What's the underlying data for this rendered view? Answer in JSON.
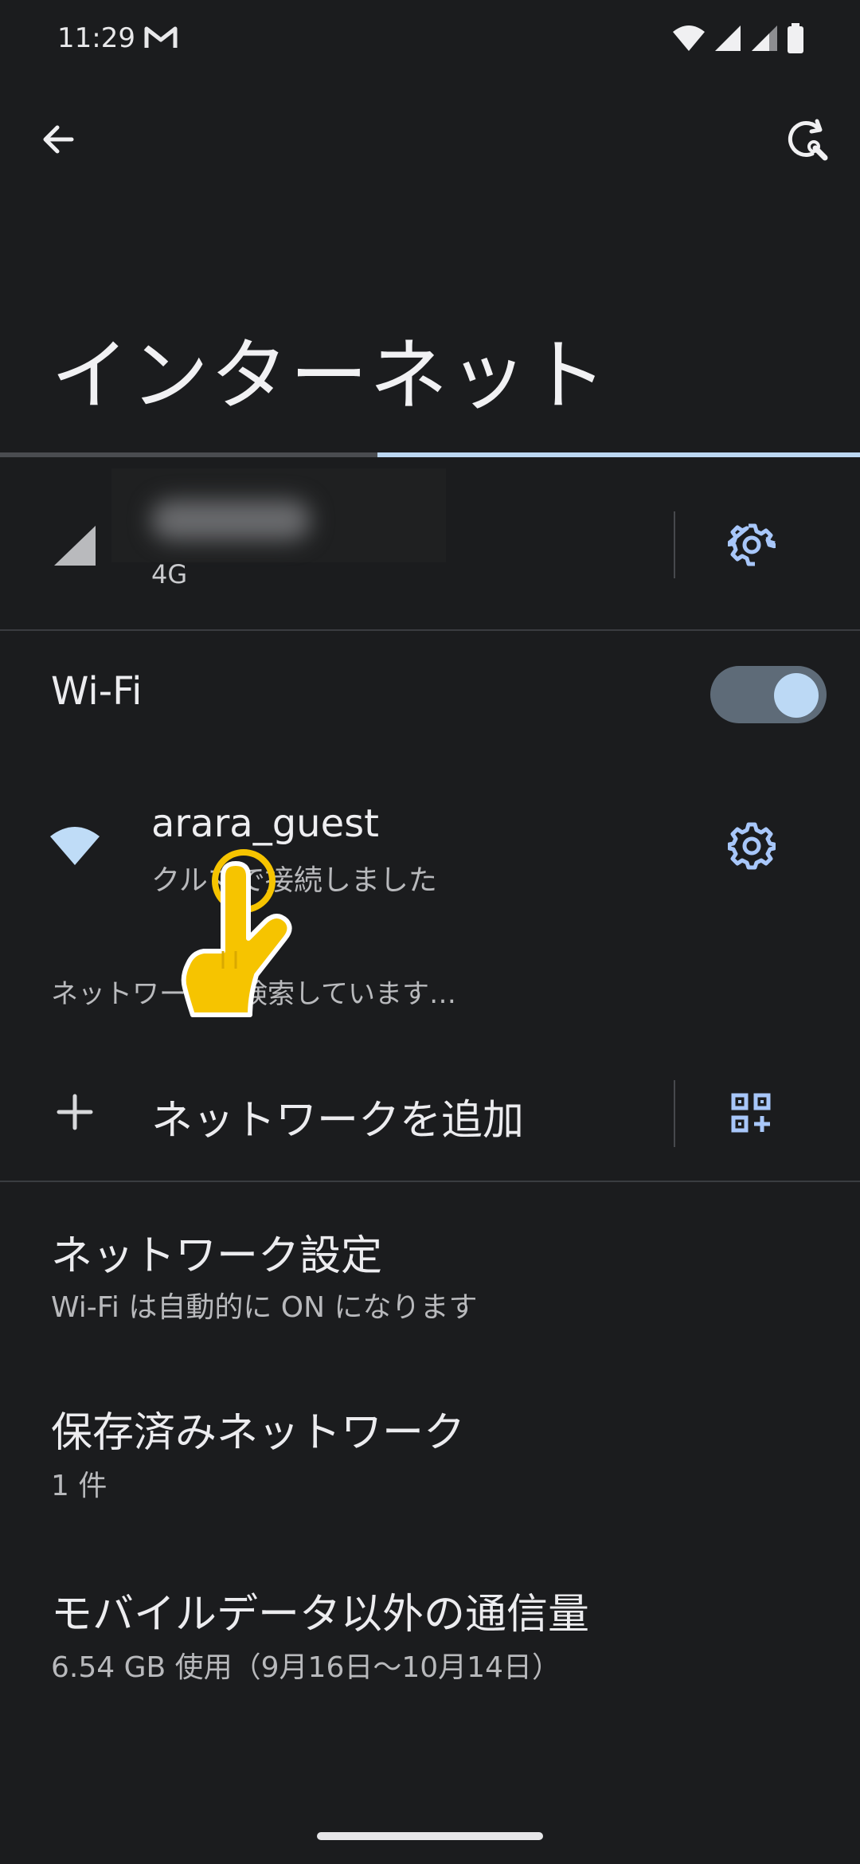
{
  "status_bar": {
    "time": "11:29",
    "icons": [
      "gmail-icon",
      "wifi-icon",
      "signal-icon",
      "signal-icon-2",
      "battery-icon"
    ]
  },
  "toolbar": {
    "back_icon": "arrow-back-icon",
    "action_icon": "refresh-wrench-icon"
  },
  "page": {
    "title": "インターネット"
  },
  "mobile": {
    "network_type": "4G",
    "settings_icon": "gear-icon"
  },
  "wifi": {
    "label": "Wi-Fi",
    "enabled": true,
    "network": {
      "name": "arara_guest",
      "status": "クルマで接続しました",
      "settings_icon": "gear-icon"
    },
    "searching_text": "ネットワークを検索しています…",
    "add_network_label": "ネットワークを追加",
    "qr_icon": "qr-add-icon"
  },
  "items": [
    {
      "title": "ネットワーク設定",
      "subtitle": "Wi-Fi は自動的に ON になります"
    },
    {
      "title": "保存済みネットワーク",
      "subtitle": "1 件"
    },
    {
      "title": "モバイルデータ以外の通信量",
      "subtitle": "6.54 GB 使用（9月16日〜10月14日）"
    }
  ],
  "colors": {
    "background": "#1b1c1e",
    "accent": "#bcd7f2",
    "touch_indicator": "#f6c400"
  }
}
